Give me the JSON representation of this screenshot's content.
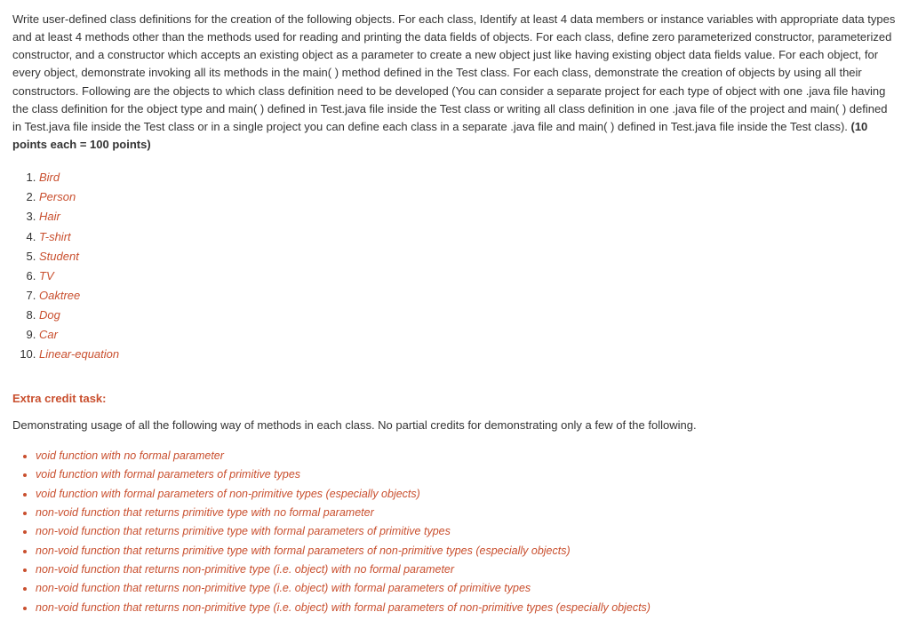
{
  "description": {
    "text_part1": "Write user-defined class definitions for the creation of the following objects. For each class, Identify at least 4 data members or instance variables with appropriate data types and at least 4 methods other than the methods used for reading and printing the data fields of objects.  For each class, define zero parameterized constructor, parameterized constructor, and a constructor which accepts an existing object as a parameter to create a new object just like having existing object data fields value. For each object, for every object, demonstrate invoking all its methods in the main( ) method defined in the Test class. For each class, demonstrate the creation of objects by using all their constructors. Following are the objects to which class definition need to be developed (You can consider a separate project for each type of object with one .java file having the class definition for the object type and main( ) defined in Test.java file inside the Test class or writing all class definition in one .java file of the project and main( ) defined in Test.java file inside the Test class or in a single project you can define each class in a separate .java file and main( ) defined in Test.java file inside the Test class). ",
    "bold_part": "(10 points each = 100 points)"
  },
  "class_list": [
    "Bird",
    "Person",
    "Hair",
    "T-shirt",
    "Student",
    "TV",
    "Oaktree",
    "Dog",
    "Car",
    "Linear-equation"
  ],
  "extra_credit": {
    "title": "Extra credit task:",
    "description": "Demonstrating usage of all the following way of methods in each class. No partial credits for demonstrating only a few of the following."
  },
  "method_list": [
    "void function with no formal parameter",
    "void function with formal parameters of primitive types",
    "void function with formal parameters of non-primitive types (especially objects)",
    "non-void function that returns primitive type with no formal parameter",
    "non-void function that returns primitive type with formal parameters of primitive types",
    "non-void function that returns primitive type with formal parameters of non-primitive types (especially objects)",
    "non-void function that returns non-primitive type (i.e. object) with no formal parameter",
    "non-void function that returns non-primitive type (i.e. object) with formal parameters of primitive types",
    "non-void function that returns non-primitive type (i.e. object) with formal parameters of non-primitive types (especially objects)"
  ]
}
